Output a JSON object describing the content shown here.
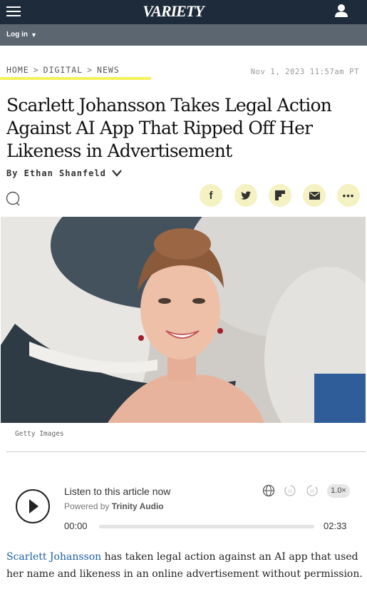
{
  "header": {
    "logo": "VARIETY",
    "menu_icon": "hamburger-menu-icon",
    "user_icon": "user-account-icon",
    "bg_color": "#1d2b3a"
  },
  "subheader": {
    "login_label": "Log in",
    "bg_color": "#5b6670"
  },
  "breadcrumb": {
    "items": [
      "HOME",
      "DIGITAL",
      "NEWS"
    ],
    "separator": ">",
    "highlight_color": "#f3f25a"
  },
  "article": {
    "timestamp": "Nov 1, 2023 11:57am PT",
    "headline": "Scarlett Johansson Takes Legal Action Against AI App That Ripped Off Her Likeness in Advertisement",
    "byline": "By Ethan Shanfeld",
    "image_credit": "Getty Images",
    "body_link": "Scarlett Johansson",
    "body_rest": " has taken legal action against an AI app that used her name and likeness in an online advertisement without permission.",
    "link_color": "#1a5fa0"
  },
  "share": {
    "icons": [
      "facebook-icon",
      "twitter-icon",
      "flipboard-icon",
      "email-icon",
      "more-icon"
    ],
    "bg_color": "#f4f2c2"
  },
  "audio": {
    "title": "Listen to this article now",
    "powered_prefix": "Powered by",
    "powered_brand": "Trinity Audio",
    "time_current": "00:00",
    "time_total": "02:33",
    "speed": "1.0×",
    "progress": 0
  }
}
